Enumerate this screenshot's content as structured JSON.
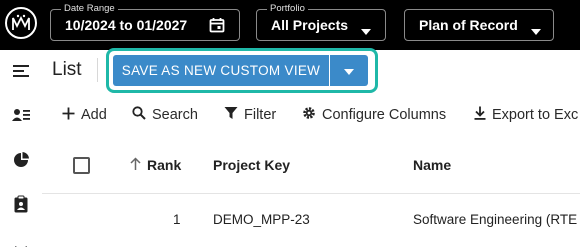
{
  "topbar": {
    "date_range": {
      "legend": "Date Range",
      "value": "10/2024 to 01/2027"
    },
    "portfolio": {
      "legend": "Portfolio",
      "value": "All Projects"
    },
    "plan": {
      "value": "Plan of Record"
    }
  },
  "header": {
    "title": "List",
    "save_view_label": "SAVE AS NEW CUSTOM VIEW"
  },
  "toolbar": {
    "add_label": "Add",
    "search_label": "Search",
    "filter_label": "Filter",
    "configure_label": "Configure Columns",
    "export_label": "Export to Exc"
  },
  "table": {
    "columns": [
      "Rank",
      "Project Key",
      "Name"
    ],
    "rows": [
      {
        "rank": "1",
        "project_key": "DEMO_MPP-23",
        "name": "Software Engineering (RTE"
      }
    ]
  },
  "colors": {
    "topbar_bg": "#000000",
    "button_blue": "#3b8ac9",
    "highlight_teal": "#1fb8a8"
  },
  "icons": [
    "logo-icon",
    "calendar-icon",
    "chevron-down-icon",
    "menu-icon",
    "people-list-icon",
    "chart-icon",
    "clipboard-icon",
    "plus-icon",
    "search-icon",
    "filter-icon",
    "gear-icon",
    "download-icon",
    "sort-arrow-icon"
  ]
}
